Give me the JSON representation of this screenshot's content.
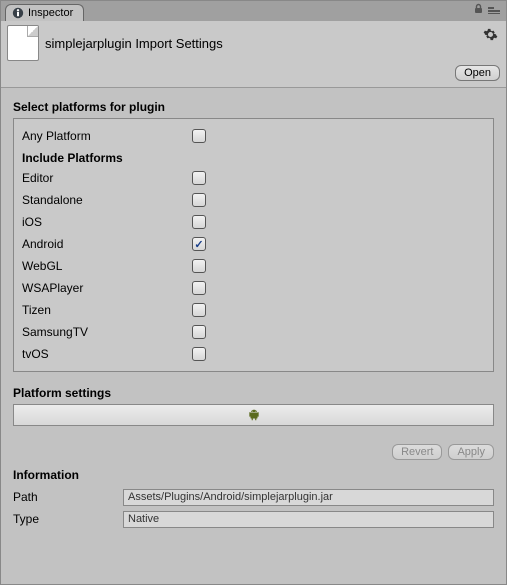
{
  "tab": {
    "title": "Inspector"
  },
  "header": {
    "title": "simplejarplugin Import Settings",
    "open_label": "Open"
  },
  "select_platforms": {
    "heading": "Select platforms for plugin",
    "any_label": "Any Platform",
    "any_checked": false,
    "include_heading": "Include Platforms",
    "platforms": [
      {
        "label": "Editor",
        "checked": false
      },
      {
        "label": "Standalone",
        "checked": false
      },
      {
        "label": "iOS",
        "checked": false
      },
      {
        "label": "Android",
        "checked": true
      },
      {
        "label": "WebGL",
        "checked": false
      },
      {
        "label": "WSAPlayer",
        "checked": false
      },
      {
        "label": "Tizen",
        "checked": false
      },
      {
        "label": "SamsungTV",
        "checked": false
      },
      {
        "label": "tvOS",
        "checked": false
      }
    ]
  },
  "platform_settings": {
    "heading": "Platform settings",
    "active_tab_icon": "android-icon"
  },
  "buttons": {
    "revert": "Revert",
    "apply": "Apply"
  },
  "information": {
    "heading": "Information",
    "path_label": "Path",
    "path_value": "Assets/Plugins/Android/simplejarplugin.jar",
    "type_label": "Type",
    "type_value": "Native"
  }
}
